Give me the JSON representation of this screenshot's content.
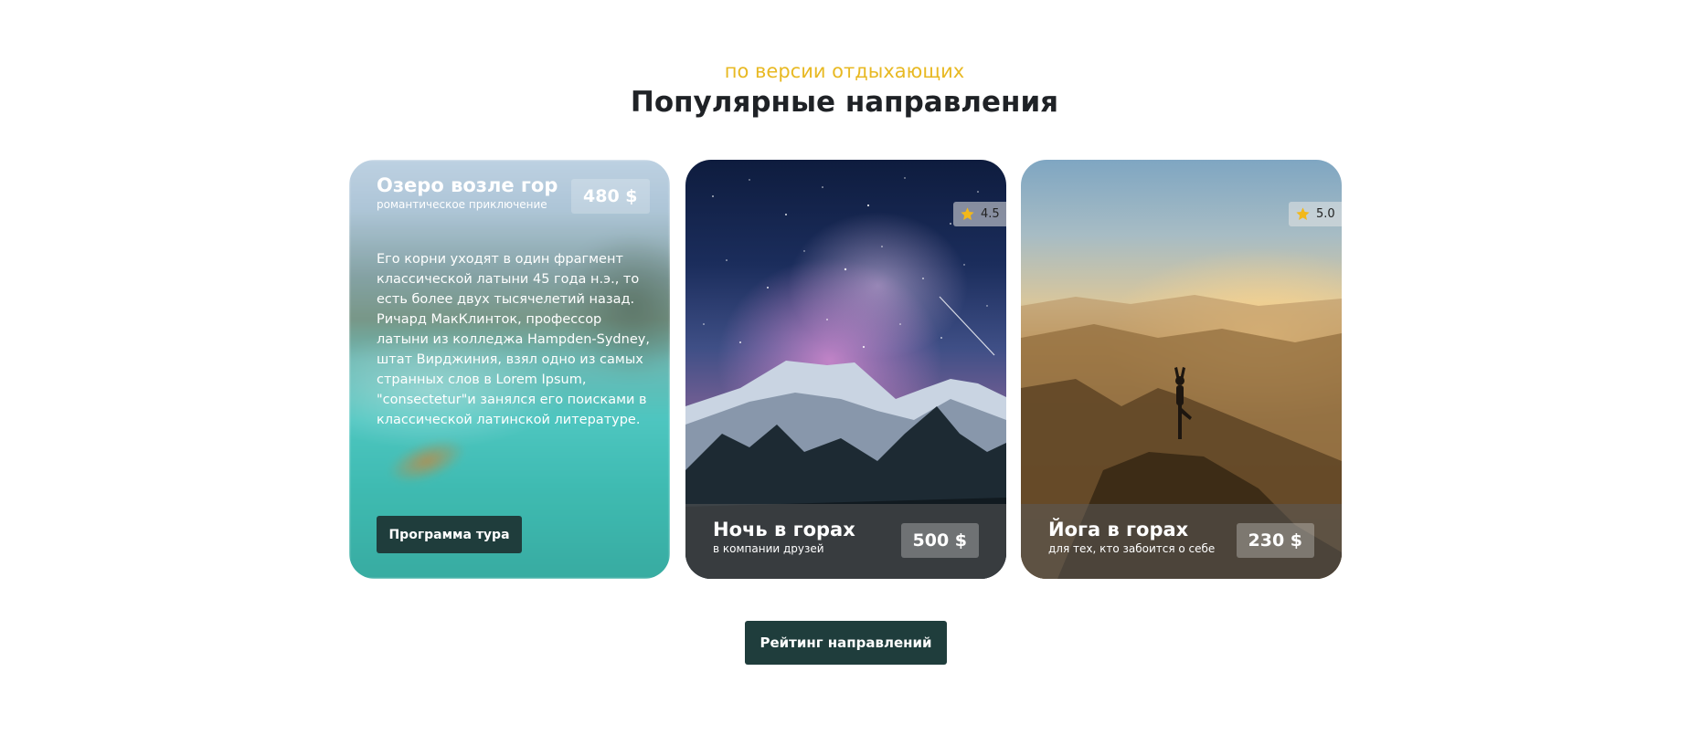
{
  "header": {
    "subtitle": "по версии отдыхающих",
    "title": "Популярные направления"
  },
  "cards": [
    {
      "name": "Озеро возле гор",
      "tagline": "романтическое приключение",
      "price": "480 $",
      "description": "Его корни уходят в один фрагмент классической латыни 45 года н.э., то есть более двух тысячелетий назад. Ричард МакКлинток, профессор латыни из колледжа Hampden-Sydney, штат Вирджиния, взял одно из самых странных слов в Lorem Ipsum, \"consectetur\"и занялся его поисками в классической латинской литературе.",
      "button_label": "Программа тура"
    },
    {
      "name": "Ночь в горах",
      "tagline": "в компании друзей",
      "price": "500 $",
      "rating": "4.5"
    },
    {
      "name": "Йога в горах",
      "tagline": "для тех, кто забоится о себе",
      "price": "230 $",
      "rating": "5.0"
    }
  ],
  "footer": {
    "button_label": "Рейтинг направлений"
  },
  "colors": {
    "accent": "#e8b923",
    "title": "#1f2226",
    "button_bg": "#1f3d3c",
    "star": "#f2b81a"
  },
  "icons": {
    "rating": "star-icon"
  }
}
